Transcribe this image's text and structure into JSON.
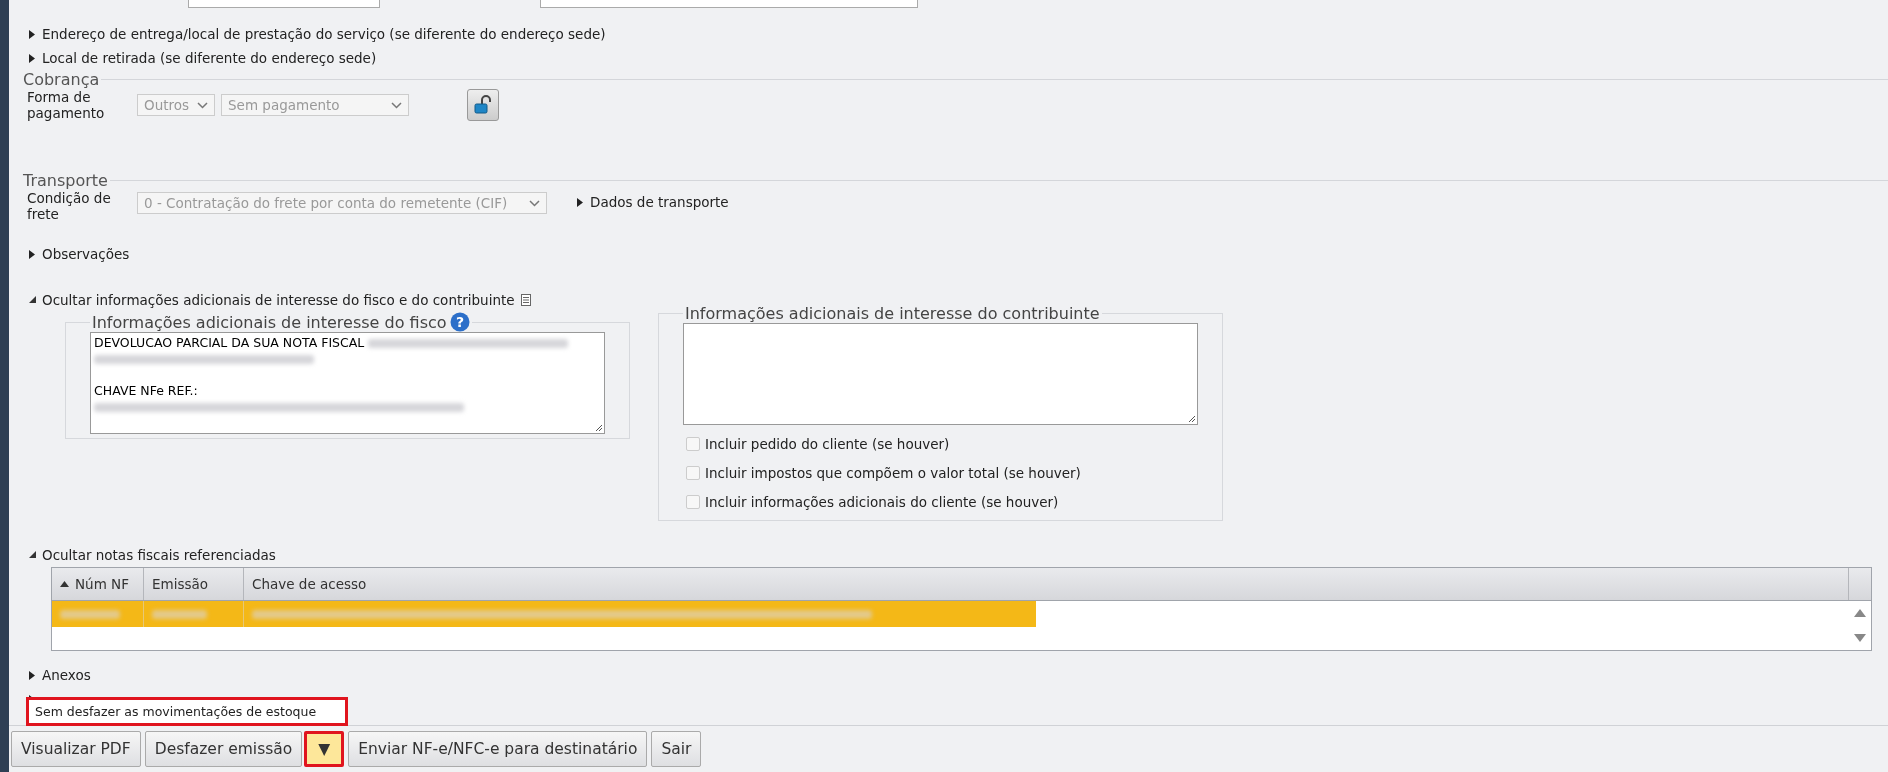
{
  "expanders_top": [
    {
      "label": "Endereço de entrega/local de prestação do serviço (se diferente do endereço sede)",
      "expanded": false
    },
    {
      "label": "Local de retirada (se diferente do endereço sede)",
      "expanded": false
    }
  ],
  "cobranca": {
    "title": "Cobrança",
    "label": "Forma de pagamento",
    "selects": [
      {
        "value": "Outros",
        "disabled": true
      },
      {
        "value": "Sem pagamento",
        "disabled": true
      }
    ]
  },
  "transporte": {
    "title": "Transporte",
    "label": "Condição de frete",
    "select": {
      "value": "0 - Contratação do frete por conta do remetente (CIF)",
      "disabled": true
    },
    "dados": {
      "label": "Dados de transporte",
      "expanded": false
    }
  },
  "observacoes": {
    "label": "Observações",
    "expanded": false
  },
  "info_adicionais": {
    "label": "Ocultar informações adicionais de interesse do fisco e do contribuinte",
    "expanded": true,
    "fisco": {
      "title": "Informações adicionais de interesse do fisco",
      "help_glyph": "?",
      "lines": [
        {
          "kind": "text",
          "text": "DEVOLUCAO PARCIAL DA SUA NOTA FISCAL",
          "redacted_tail": true
        },
        {
          "kind": "redacted"
        },
        {
          "kind": "blank"
        },
        {
          "kind": "text",
          "text": "CHAVE NFe REF.:"
        },
        {
          "kind": "redacted"
        }
      ]
    },
    "contribuinte": {
      "title": "Informações adicionais de interesse do contribuinte",
      "options": [
        {
          "label": "Incluir pedido do cliente (se houver)",
          "checked": false,
          "disabled": true
        },
        {
          "label": "Incluir impostos que compõem o valor total (se houver)",
          "checked": false,
          "disabled": true
        },
        {
          "label": "Incluir informações adicionais do cliente (se houver)",
          "checked": false,
          "disabled": true
        }
      ]
    }
  },
  "notas_referenciadas": {
    "label": "Ocultar notas fiscais referenciadas",
    "expanded": true,
    "columns": [
      {
        "label": "Núm NF",
        "sorted": true
      },
      {
        "label": "Emissão",
        "sorted": false
      },
      {
        "label": "Chave de acesso",
        "sorted": false
      }
    ],
    "rows": [
      {
        "selected": true
      }
    ]
  },
  "expanders_bottom": [
    {
      "label": "Anexos",
      "expanded": false
    },
    {
      "expanded": false
    }
  ],
  "dropdown_menu": {
    "items": [
      {
        "label": "Sem desfazer as movimentações de estoque",
        "highlighted": true
      }
    ]
  },
  "buttons": [
    {
      "label": "Visualizar PDF",
      "kind": "button",
      "highlighted": false
    },
    {
      "label": "Desfazer emissão",
      "kind": "button",
      "highlighted": false
    },
    {
      "label": "▼",
      "kind": "toggle",
      "highlighted": true
    },
    {
      "label": "Enviar NF-e/NFC-e para destinatário",
      "kind": "button",
      "highlighted": false
    },
    {
      "label": "Sair",
      "kind": "button",
      "highlighted": false
    }
  ]
}
